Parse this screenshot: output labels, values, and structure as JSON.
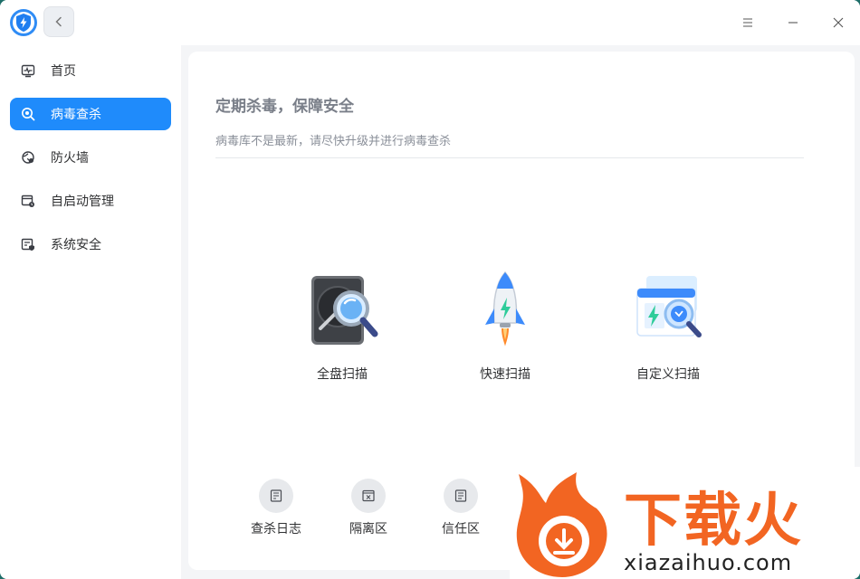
{
  "sidebar": {
    "items": [
      {
        "label": "首页",
        "icon": "monitor-pulse-icon",
        "active": false
      },
      {
        "label": "病毒查杀",
        "icon": "virus-scan-icon",
        "active": true
      },
      {
        "label": "防火墙",
        "icon": "firewall-icon",
        "active": false
      },
      {
        "label": "自启动管理",
        "icon": "startup-manager-icon",
        "active": false
      },
      {
        "label": "系统安全",
        "icon": "system-security-icon",
        "active": false
      }
    ]
  },
  "main": {
    "title": "定期杀毒，保障安全",
    "subtitle": "病毒库不是最新，请尽快升级并进行病毒查杀",
    "scans": [
      {
        "label": "全盘扫描",
        "icon": "full-disk-scan-icon"
      },
      {
        "label": "快速扫描",
        "icon": "rocket-quick-scan-icon"
      },
      {
        "label": "自定义扫描",
        "icon": "custom-scan-icon"
      }
    ],
    "tools": [
      {
        "label": "查杀日志",
        "icon": "log-icon"
      },
      {
        "label": "隔离区",
        "icon": "quarantine-icon"
      },
      {
        "label": "信任区",
        "icon": "trust-zone-icon"
      }
    ]
  },
  "watermark": {
    "brand": "下载火",
    "url": "xiazaihuo.com"
  },
  "colors": {
    "accent": "#1f8bfb",
    "watermark": "#f26522"
  }
}
